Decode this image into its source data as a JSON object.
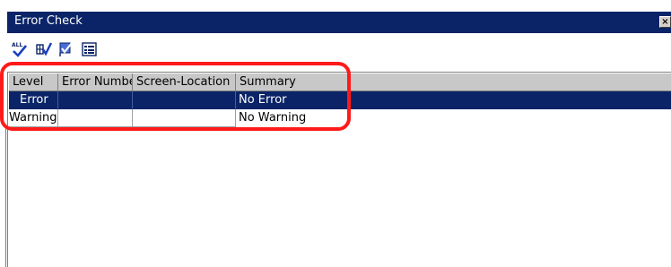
{
  "window": {
    "title": "Error Check",
    "close_label": "×"
  },
  "toolbar": {
    "buttons": [
      {
        "name": "check-all",
        "icon": "check-all-icon"
      },
      {
        "name": "check-selected",
        "icon": "check-screen-icon"
      },
      {
        "name": "check-item",
        "icon": "check-flag-icon"
      },
      {
        "name": "error-list",
        "icon": "list-icon"
      }
    ]
  },
  "grid": {
    "columns": [
      {
        "label": "Level"
      },
      {
        "label": "Error Numbe"
      },
      {
        "label": "Screen-Location"
      },
      {
        "label": "Summary"
      }
    ],
    "rows": [
      {
        "level": "Error",
        "error_number": "",
        "screen_location": "",
        "summary": "No Error",
        "selected": true
      },
      {
        "level": "Warning",
        "error_number": "",
        "screen_location": "",
        "summary": "No Warning",
        "selected": false
      }
    ]
  },
  "colors": {
    "titlebar": "#0a2467",
    "selection": "#0a2467",
    "highlight": "#ff1a1a",
    "header_bg": "#c8c8c8"
  }
}
